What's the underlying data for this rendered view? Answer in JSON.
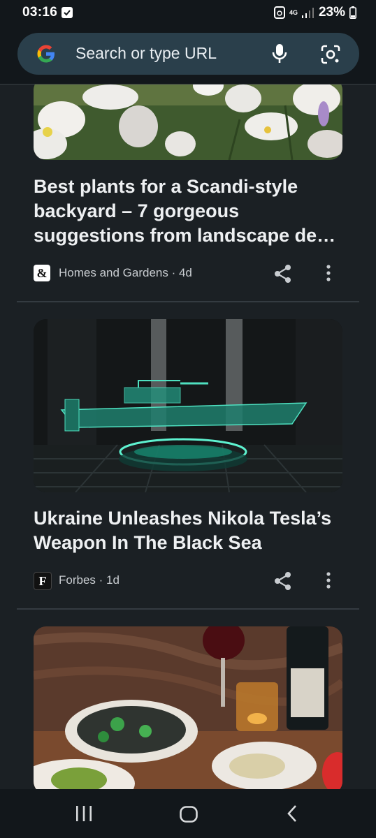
{
  "status_bar": {
    "time": "03:16",
    "network": "4G",
    "battery": "23%",
    "icons": [
      "check-notification-icon",
      "recycle-icon",
      "signal-icon",
      "battery-icon"
    ]
  },
  "search": {
    "placeholder": "Search or type URL",
    "icons": [
      "google-g-icon",
      "microphone-icon",
      "camera-lens-icon"
    ]
  },
  "feed": {
    "cards": [
      {
        "headline": "Best plants for a Scandi-style backyard – 7 gorgeous suggestions from landscape de…",
        "source": "Homes and Gardens · 4d",
        "source_logo": "&",
        "image": "white anemone flowers"
      },
      {
        "headline": "Ukraine Unleashes Nikola Tesla’s Weapon In The Black Sea",
        "source": "Forbes · 1d",
        "source_logo": "F",
        "image": "holographic boat on platform"
      },
      {
        "image": "seafood dinner table with wine"
      }
    ]
  },
  "colors": {
    "background": "#1b2024",
    "search_box": "#2a3f4b",
    "bar": "#12171b"
  }
}
